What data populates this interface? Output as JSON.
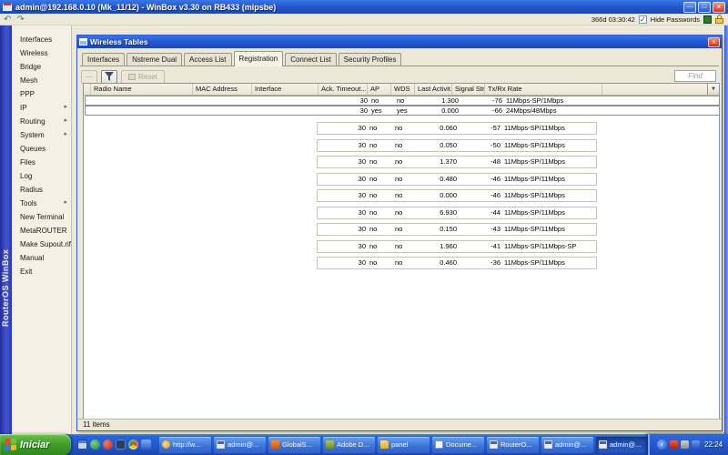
{
  "app": {
    "title": "admin@192.168.0.10 (Mk_11/12) - WinBox v3.30 on RB433 (mipsbe)",
    "uptime": "366d 03:30:42",
    "hide_passwords_label": "Hide Passwords",
    "brand_vertical": "RouterOS WinBox"
  },
  "icons": {
    "undo": "↶",
    "redo": "↷",
    "check": "✓",
    "close": "×",
    "minimize": "—",
    "maximize": "□",
    "dropdown": "▼",
    "submenu": "▸",
    "minus": "—",
    "collapse": "‹"
  },
  "sidebar": {
    "items": [
      {
        "label": "Interfaces",
        "arrow": false
      },
      {
        "label": "Wireless",
        "arrow": false
      },
      {
        "label": "Bridge",
        "arrow": false
      },
      {
        "label": "Mesh",
        "arrow": false
      },
      {
        "label": "PPP",
        "arrow": false
      },
      {
        "label": "IP",
        "arrow": true
      },
      {
        "label": "Routing",
        "arrow": true
      },
      {
        "label": "System",
        "arrow": true
      },
      {
        "label": "Queues",
        "arrow": false
      },
      {
        "label": "Files",
        "arrow": false
      },
      {
        "label": "Log",
        "arrow": false
      },
      {
        "label": "Radius",
        "arrow": false
      },
      {
        "label": "Tools",
        "arrow": true
      },
      {
        "label": "New Terminal",
        "arrow": false
      },
      {
        "label": "MetaROUTER",
        "arrow": false
      },
      {
        "label": "Make Supout.rif",
        "arrow": false
      },
      {
        "label": "Manual",
        "arrow": false
      },
      {
        "label": "Exit",
        "arrow": false
      }
    ]
  },
  "wireless": {
    "title": "Wireless Tables",
    "tabs": [
      "Interfaces",
      "Nstreme Dual",
      "Access List",
      "Registration",
      "Connect List",
      "Security Profiles"
    ],
    "active_tab": "Registration",
    "toolbar": {
      "reset_label": "Reset",
      "find_label": "Find"
    },
    "columns": [
      "Radio Name",
      "MAC Address",
      "Interface",
      "Ack. Timeout...",
      "AP",
      "WDS",
      "Last Activit...",
      "Signal Stre...",
      "Tx/Rx Rate"
    ],
    "rows": [
      {
        "ack": "30",
        "ap": "no",
        "wds": "no",
        "last": "1.300",
        "signal": "-76",
        "rate": "11Mbps-SP/1Mbps",
        "selected": true
      },
      {
        "ack": "30",
        "ap": "yes",
        "wds": "yes",
        "last": "0.000",
        "signal": "-66",
        "rate": "24Mbps/48Mbps",
        "selected": true
      },
      {
        "ack": "30",
        "ap": "no",
        "wds": "no",
        "last": "0.060",
        "signal": "-57",
        "rate": "11Mbps-SP/11Mbps",
        "selected": false
      },
      {
        "ack": "30",
        "ap": "no",
        "wds": "no",
        "last": "0.050",
        "signal": "-50",
        "rate": "11Mbps-SP/11Mbps",
        "selected": false
      },
      {
        "ack": "30",
        "ap": "no",
        "wds": "no",
        "last": "1.370",
        "signal": "-48",
        "rate": "11Mbps-SP/11Mbps",
        "selected": false
      },
      {
        "ack": "30",
        "ap": "no",
        "wds": "no",
        "last": "0.480",
        "signal": "-46",
        "rate": "11Mbps-SP/11Mbps",
        "selected": false
      },
      {
        "ack": "30",
        "ap": "no",
        "wds": "no",
        "last": "0.000",
        "signal": "-46",
        "rate": "11Mbps-SP/11Mbps",
        "selected": false
      },
      {
        "ack": "30",
        "ap": "no",
        "wds": "no",
        "last": "6.930",
        "signal": "-44",
        "rate": "11Mbps-SP/11Mbps",
        "selected": false
      },
      {
        "ack": "30",
        "ap": "no",
        "wds": "no",
        "last": "0.150",
        "signal": "-43",
        "rate": "11Mbps-SP/11Mbps",
        "selected": false
      },
      {
        "ack": "30",
        "ap": "no",
        "wds": "no",
        "last": "1.960",
        "signal": "-41",
        "rate": "11Mbps-SP/11Mbps-SP",
        "selected": false
      },
      {
        "ack": "30",
        "ap": "no",
        "wds": "no",
        "last": "0.460",
        "signal": "-36",
        "rate": "11Mbps-SP/11Mbps",
        "selected": false
      }
    ],
    "status": "11 items"
  },
  "taskbar": {
    "start_label": "Iniciar",
    "quicklaunch": [
      "desktop-icon",
      "shield-icon",
      "opera-icon",
      "phone-icon",
      "chrome-icon",
      "messenger-icon"
    ],
    "buttons": [
      {
        "label": "http://w...",
        "icon": "globe",
        "active": false
      },
      {
        "label": "admin@...",
        "icon": "winbox",
        "active": false
      },
      {
        "label": "GlobalS...",
        "icon": "globalsat",
        "active": false
      },
      {
        "label": "Adobe D...",
        "icon": "dreamweaver",
        "active": false
      },
      {
        "label": "panel",
        "icon": "folder",
        "active": false
      },
      {
        "label": "Docume...",
        "icon": "document",
        "active": false
      },
      {
        "label": "RouterO...",
        "icon": "winbox",
        "active": false
      },
      {
        "label": "admin@...",
        "icon": "winbox",
        "active": false
      },
      {
        "label": "admin@...",
        "icon": "winbox",
        "active": true
      }
    ],
    "tray_icons": [
      "security-icon",
      "display-icon",
      "network-icon"
    ],
    "clock": "22:24"
  },
  "colors": {
    "accent_blue": "#2456c8",
    "taskbar_active": "#1f4bb0",
    "start_green": "#3a9a28",
    "status_green": "#2a7a2a"
  }
}
